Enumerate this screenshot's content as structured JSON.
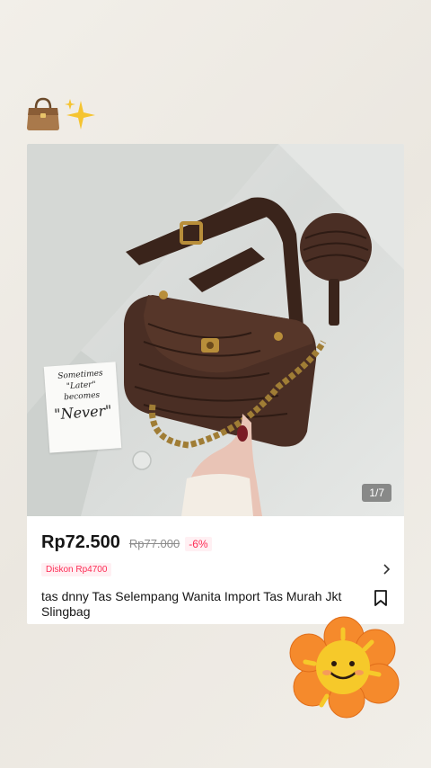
{
  "photo": {
    "note_lines": [
      "Sometimes",
      "\"Later\"",
      "becomes",
      "\"Never\""
    ],
    "counter": "1/7"
  },
  "product": {
    "price": "Rp72.500",
    "original_price": "Rp77.000",
    "discount_percent": "-6%",
    "discount_badge": "Diskon Rp4700",
    "title": "tas dnny Tas Selempang Wanita Import Tas Murah Jkt Slingbag"
  },
  "icons": {
    "decor_left": "handbag-icon",
    "decor_sparkle": "sparkles-icon",
    "chevron": "chevron-right-icon",
    "bookmark": "bookmark-icon",
    "sticker": "sun-flower-sticker"
  },
  "colors": {
    "accent": "#fe2c55",
    "bag": "#4a2e24",
    "sticker_orange": "#f58a2c",
    "sticker_yellow": "#f6c92a"
  }
}
